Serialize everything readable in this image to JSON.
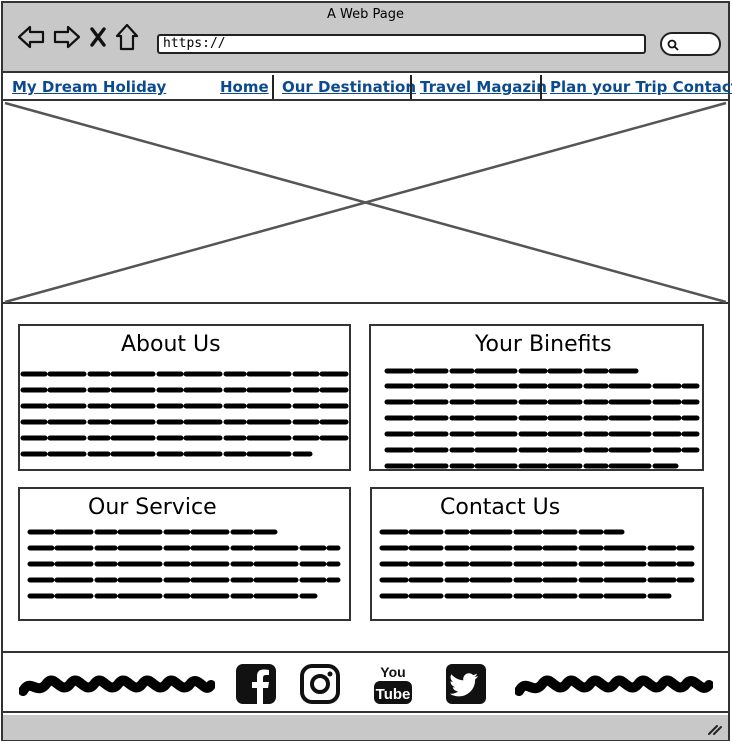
{
  "window": {
    "title": "A Web Page"
  },
  "browser": {
    "url": "https://"
  },
  "nav": {
    "brand": "My Dream Holiday",
    "items": [
      {
        "label": "Home"
      },
      {
        "label": "Our Destination"
      },
      {
        "label": "Travel Magazin"
      },
      {
        "label": "Plan your Trip Contact"
      }
    ]
  },
  "sections": [
    {
      "title": "About Us"
    },
    {
      "title": "Your Binefits"
    },
    {
      "title": "Our Service"
    },
    {
      "title": "Contact Us"
    }
  ],
  "footer": {
    "social": [
      "facebook-icon",
      "instagram-icon",
      "youtube-icon",
      "twitter-icon"
    ],
    "youtube_top": "You",
    "youtube_bottom": "Tube"
  }
}
